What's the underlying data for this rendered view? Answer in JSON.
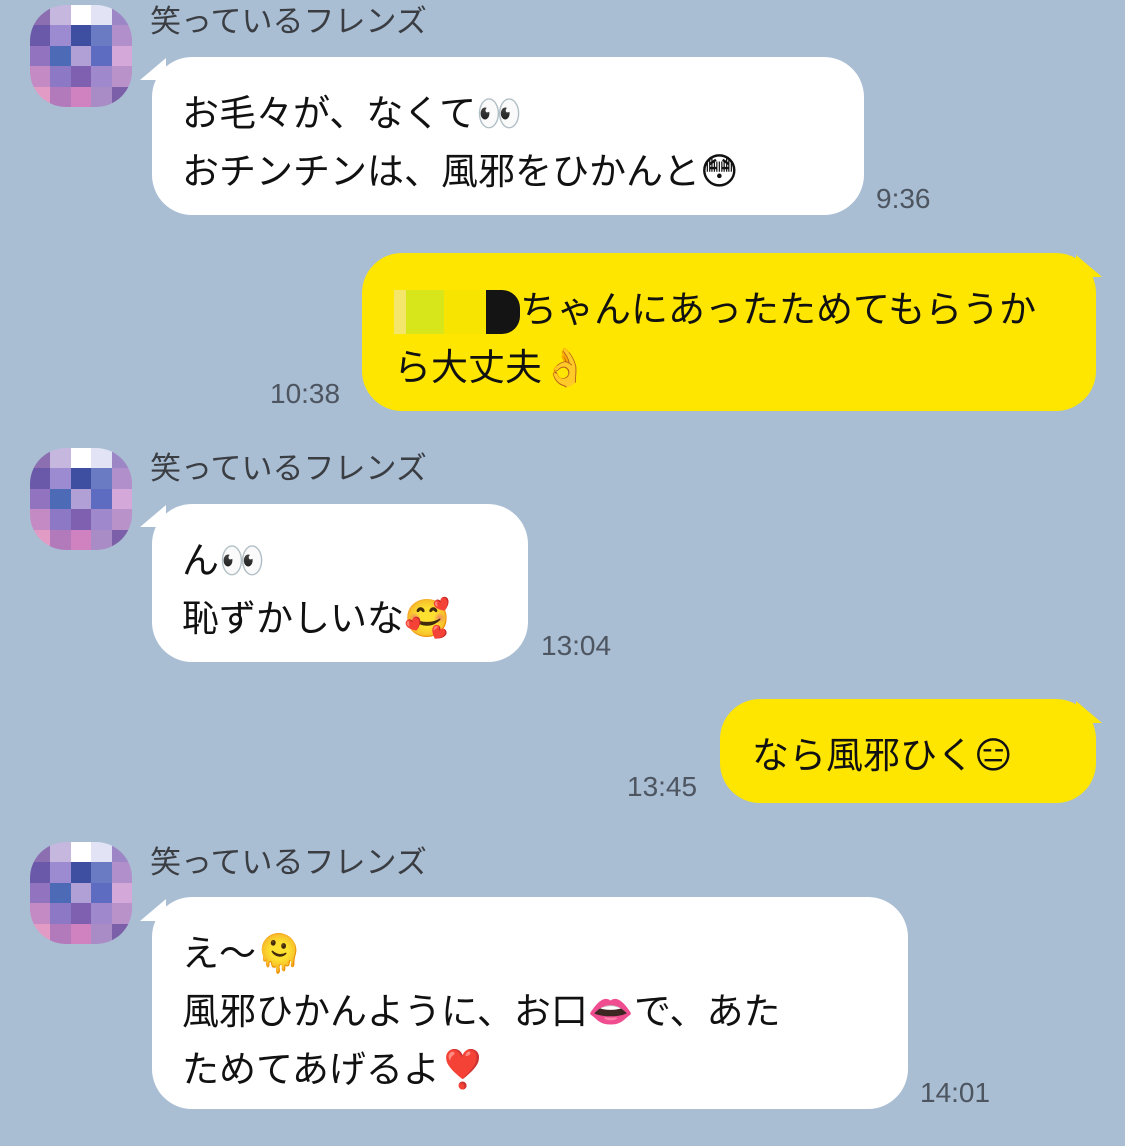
{
  "contact": {
    "name": "笑っているフレンズ"
  },
  "avatar_colors": [
    "#8b6fb0",
    "#c6b7de",
    "#ffffff",
    "#e2e3f5",
    "#9d86c6",
    "#6a59a8",
    "#9c8bd0",
    "#3e4fa1",
    "#6a7bc4",
    "#b18fca",
    "#9173c0",
    "#4d6ab7",
    "#b1a0d6",
    "#5d6cc0",
    "#d4a8d8",
    "#c48ac4",
    "#8d78c5",
    "#7f60b0",
    "#9f89cc",
    "#b892c9",
    "#e29bc5",
    "#b279bb",
    "#d081c0",
    "#a98cc6",
    "#7b5fa8"
  ],
  "messages": [
    {
      "side": "in",
      "lines": [
        "お毛々が、なくて👀",
        "おチンチンは、風邪をひかんと😳"
      ],
      "time": "9:36"
    },
    {
      "side": "out",
      "lines": [
        "ちゃんにあったためてもらうか",
        "ら大丈夫👌"
      ],
      "time": "10:38"
    },
    {
      "side": "in",
      "lines": [
        "ん👀",
        "恥ずかしいな🥰"
      ],
      "time": "13:04"
    },
    {
      "side": "out",
      "lines": [
        "なら風邪ひく😑"
      ],
      "time": "13:45"
    },
    {
      "side": "in",
      "lines": [
        "え〜🫠",
        "風邪ひかんように、お口👄で、あた",
        "ためてあげるよ❣️"
      ],
      "time": "14:01"
    }
  ]
}
